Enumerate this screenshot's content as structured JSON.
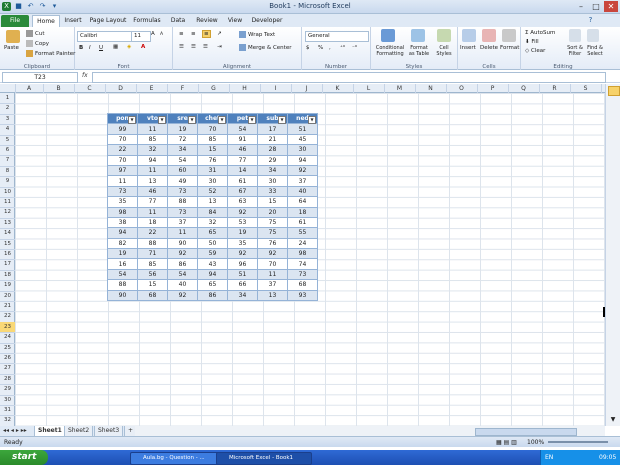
{
  "window": {
    "title": "Book1 - Microsoft Excel"
  },
  "tabs": [
    "File",
    "Home",
    "Insert",
    "Page Layout",
    "Formulas",
    "Data",
    "Review",
    "View",
    "Developer"
  ],
  "ribbon": {
    "clipboard": {
      "label": "Clipboard",
      "paste": "Paste",
      "cut": "Cut",
      "copy": "Copy",
      "painter": "Format Painter"
    },
    "font": {
      "label": "Font",
      "name": "Calibri",
      "size": "11",
      "bold": "B",
      "italic": "I",
      "underline": "U"
    },
    "alignment": {
      "label": "Alignment",
      "wrap": "Wrap Text",
      "merge": "Merge & Center"
    },
    "number": {
      "label": "Number",
      "format": "General",
      "percent": "%"
    },
    "styles": {
      "label": "Styles",
      "conditional": "Conditional Formatting",
      "table": "Format as Table",
      "cell": "Cell Styles"
    },
    "cells": {
      "label": "Cells",
      "insert": "Insert",
      "delete": "Delete",
      "format": "Format"
    },
    "editing": {
      "label": "Editing",
      "autosum": "AutoSum",
      "fill": "Fill",
      "clear": "Clear",
      "sort": "Sort & Filter",
      "find": "Find & Select"
    }
  },
  "formula": {
    "namebox": "T23",
    "fx": "fx",
    "value": ""
  },
  "columns": [
    "A",
    "B",
    "C",
    "D",
    "E",
    "F",
    "G",
    "H",
    "I",
    "J",
    "K",
    "L",
    "M",
    "N",
    "O",
    "P",
    "Q",
    "R",
    "S"
  ],
  "rows": [
    "1",
    "2",
    "3",
    "4",
    "5",
    "6",
    "7",
    "8",
    "9",
    "10",
    "11",
    "12",
    "13",
    "14",
    "15",
    "16",
    "17",
    "18",
    "19",
    "20",
    "21",
    "22",
    "23",
    "24",
    "25",
    "26",
    "27",
    "28",
    "29",
    "30",
    "31",
    "32"
  ],
  "table": {
    "headers": [
      "pon",
      "vto",
      "sre",
      "chet",
      "pet",
      "sub",
      "ned"
    ],
    "rows": [
      [
        "99",
        "11",
        "19",
        "70",
        "54",
        "17",
        "51"
      ],
      [
        "70",
        "85",
        "72",
        "85",
        "91",
        "21",
        "45"
      ],
      [
        "22",
        "32",
        "34",
        "15",
        "46",
        "28",
        "30"
      ],
      [
        "70",
        "94",
        "54",
        "76",
        "77",
        "29",
        "94"
      ],
      [
        "97",
        "11",
        "60",
        "31",
        "14",
        "34",
        "92"
      ],
      [
        "11",
        "13",
        "49",
        "30",
        "61",
        "30",
        "37"
      ],
      [
        "73",
        "46",
        "73",
        "52",
        "67",
        "33",
        "40"
      ],
      [
        "35",
        "77",
        "88",
        "13",
        "63",
        "15",
        "64"
      ],
      [
        "98",
        "11",
        "73",
        "84",
        "92",
        "20",
        "18"
      ],
      [
        "38",
        "18",
        "37",
        "32",
        "53",
        "75",
        "61"
      ],
      [
        "94",
        "22",
        "11",
        "65",
        "19",
        "75",
        "55"
      ],
      [
        "82",
        "88",
        "90",
        "50",
        "35",
        "76",
        "24"
      ],
      [
        "19",
        "71",
        "92",
        "59",
        "92",
        "92",
        "98"
      ],
      [
        "16",
        "85",
        "86",
        "43",
        "96",
        "70",
        "74"
      ],
      [
        "54",
        "56",
        "54",
        "94",
        "51",
        "11",
        "73"
      ],
      [
        "88",
        "15",
        "40",
        "65",
        "66",
        "37",
        "68"
      ],
      [
        "90",
        "68",
        "92",
        "86",
        "34",
        "13",
        "93"
      ]
    ]
  },
  "sheets": [
    "Sheet1",
    "Sheet2",
    "Sheet3"
  ],
  "status": {
    "ready": "Ready",
    "zoom": "100%"
  },
  "taskbar": {
    "start": "start",
    "items": [
      "Aula.bg - Question - ...",
      "Microsoft Excel - Book1"
    ],
    "lang": "EN",
    "time": "09:05"
  }
}
